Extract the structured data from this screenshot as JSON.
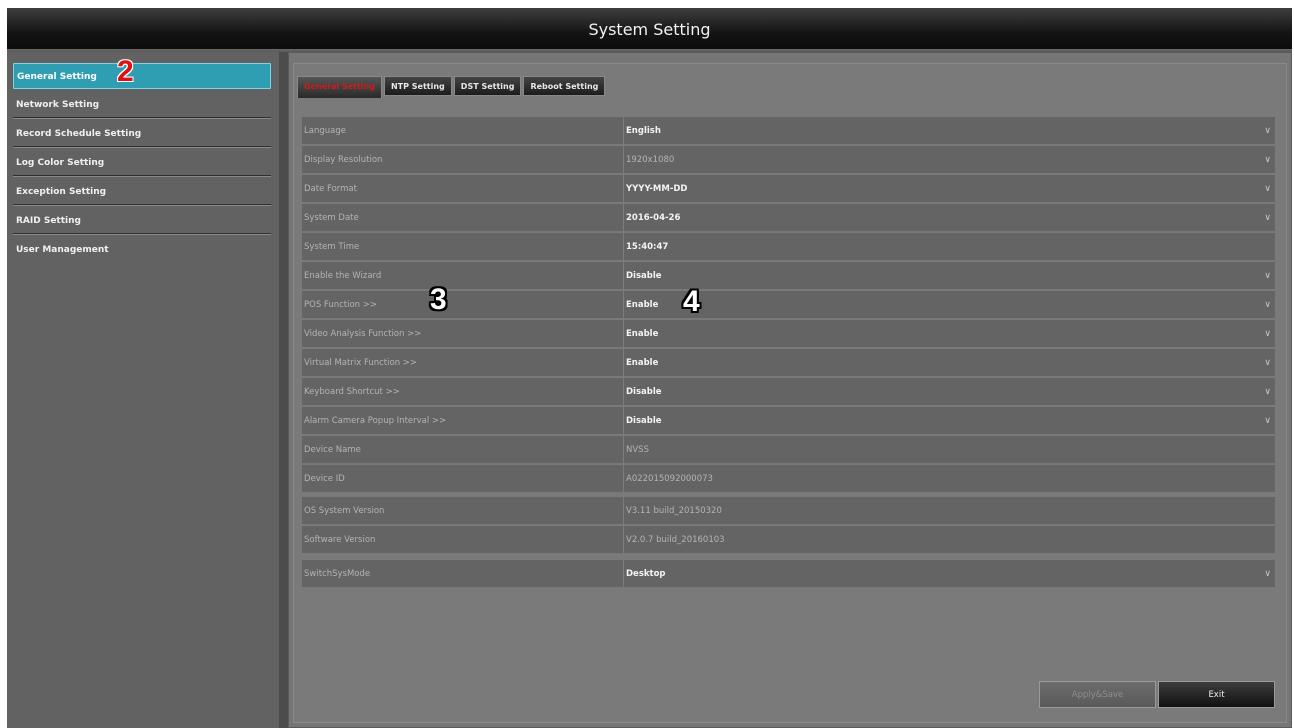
{
  "window": {
    "title": "System Setting"
  },
  "sidebar": {
    "items": [
      {
        "label": "General Setting",
        "active": true
      },
      {
        "label": "Network Setting"
      },
      {
        "label": "Record Schedule Setting"
      },
      {
        "label": "Log Color Setting"
      },
      {
        "label": "Exception Setting"
      },
      {
        "label": "RAID Setting"
      },
      {
        "label": "User Management"
      }
    ]
  },
  "tabs": [
    {
      "label": "General Setting",
      "active": true
    },
    {
      "label": "NTP Setting"
    },
    {
      "label": "DST Setting"
    },
    {
      "label": "Reboot Setting"
    }
  ],
  "settings": {
    "main": [
      {
        "label": "Language",
        "value": "English",
        "dropdown": true
      },
      {
        "label": "Display Resolution",
        "value": "1920x1080",
        "dropdown": true,
        "disabled": true
      },
      {
        "label": "Date Format",
        "value": "YYYY-MM-DD",
        "dropdown": true
      },
      {
        "label": "System Date",
        "value": "2016-04-26",
        "dropdown": true
      },
      {
        "label": "System Time",
        "value": "15:40:47",
        "dropdown": false
      },
      {
        "label": "Enable the Wizard",
        "value": "Disable",
        "dropdown": true
      },
      {
        "label": "POS Function  >>",
        "value": "Enable",
        "dropdown": true
      },
      {
        "label": "Video Analysis Function  >>",
        "value": "Enable",
        "dropdown": true
      },
      {
        "label": "Virtual Matrix Function  >>",
        "value": "Enable",
        "dropdown": true
      },
      {
        "label": "Keyboard Shortcut  >>",
        "value": "Disable",
        "dropdown": true
      },
      {
        "label": "Alarm Camera Popup Interval  >>",
        "value": "Disable",
        "dropdown": true
      },
      {
        "label": "Device Name",
        "value": "NVSS",
        "dropdown": false,
        "disabled": true
      },
      {
        "label": "Device ID",
        "value": "A022015092000073",
        "dropdown": false,
        "disabled": true
      }
    ],
    "version": [
      {
        "label": "OS System Version",
        "value": "V3.11 build_20150320",
        "disabled": true
      },
      {
        "label": "Software Version",
        "value": "V2.0.7 build_20160103",
        "disabled": true
      }
    ],
    "mode": [
      {
        "label": "SwitchSysMode",
        "value": "Desktop",
        "dropdown": true
      }
    ]
  },
  "annotations": [
    "2",
    "3",
    "4"
  ],
  "buttons": {
    "apply_label": "Apply&Save",
    "exit_label": "Exit"
  },
  "icons": {
    "dropdown": "chevron-down-icon"
  },
  "colors": {
    "active_item": "#2f9db2",
    "active_tab_text": "#d01c1c"
  }
}
